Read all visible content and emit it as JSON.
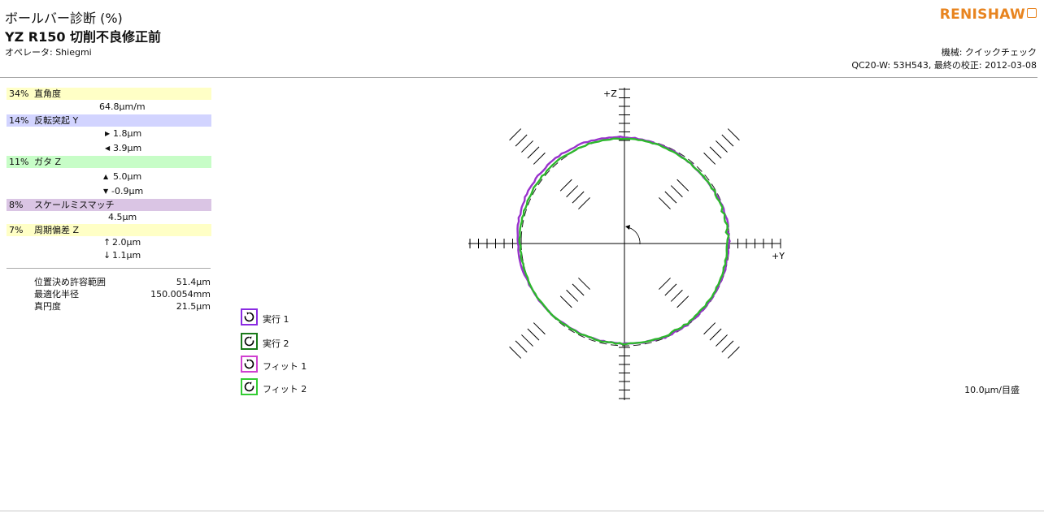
{
  "header": {
    "title": "ボールバー診断 (%)",
    "subtitle": "YZ  R150  切削不良修正前",
    "operator": "オペレータ: Shiegmi",
    "logo_text": "RENISHAW",
    "machine": "機械: クイックチェック",
    "calibration": "QC20-W: 53H543, 最終の校正: 2012-03-08"
  },
  "diagnostics": {
    "squareness": {
      "percent": "34%",
      "label": "直角度",
      "value": "64.8µm/m",
      "color": "#ffffc6"
    },
    "backlash_y": {
      "percent": "14%",
      "label": "反転突起 Y",
      "value_pos": "1.8µm",
      "value_neg": "3.9µm",
      "color": "#d2d4ff"
    },
    "play_z": {
      "percent": "11%",
      "label": "ガタ Z",
      "value_pos": "5.0µm",
      "value_neg": "-0.9µm",
      "color": "#c7fdc7"
    },
    "scale_mismatch": {
      "percent": "8%",
      "label": "スケールミスマッチ",
      "value": "4.5µm",
      "color": "#dac5e4"
    },
    "cyclic_error_z": {
      "percent": "7%",
      "label": "周期偏差 Z",
      "value_up": "2.0µm",
      "value_down": "1.1µm",
      "color": "#ffffc6"
    }
  },
  "stats": [
    {
      "label": "位置決め許容範囲",
      "value": "51.4µm"
    },
    {
      "label": "最適化半径",
      "value": "150.0054mm"
    },
    {
      "label": "真円度",
      "value": "21.5µm"
    }
  ],
  "legend": [
    {
      "label": "実行 1",
      "color": "#8a2be2",
      "direction": "cw"
    },
    {
      "label": "実行 2",
      "color": "#1a7a1a",
      "direction": "ccw"
    },
    {
      "label": "フィット 1",
      "color": "#d040d0",
      "direction": "cw"
    },
    {
      "label": "フィット 2",
      "color": "#33cc33",
      "direction": "ccw"
    }
  ],
  "plot": {
    "axis_y_label": "+Y",
    "axis_z_label": "+Z",
    "scale_text": "10.0µm/目盛",
    "run1_color": "#9932cc",
    "run2_color": "#2db82d",
    "reference_color": "#222222"
  }
}
